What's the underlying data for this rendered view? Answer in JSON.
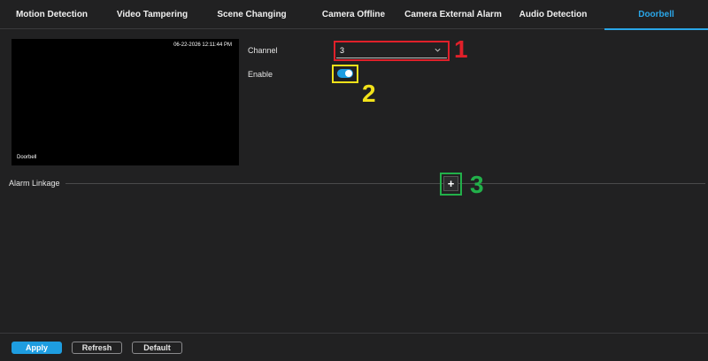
{
  "tabs": [
    {
      "label": "Motion Detection"
    },
    {
      "label": "Video Tampering"
    },
    {
      "label": "Scene Changing"
    },
    {
      "label": "Camera Offline"
    },
    {
      "label": "Camera External Alarm"
    },
    {
      "label": "Audio Detection"
    },
    {
      "label": "Doorbell"
    }
  ],
  "active_tab": "Doorbell",
  "preview": {
    "timestamp": "06-22-2026 12:11:44 PM",
    "camera_name": "Doorbell"
  },
  "form": {
    "channel_label": "Channel",
    "channel_value": "3",
    "enable_label": "Enable",
    "enable_on": true,
    "alarm_linkage_label": "Alarm Linkage",
    "add_symbol": "+"
  },
  "annotations": [
    {
      "number": "1",
      "color": "#e0202a"
    },
    {
      "number": "2",
      "color": "#f2e21a"
    },
    {
      "number": "3",
      "color": "#22b04a"
    }
  ],
  "footer": {
    "apply_label": "Apply",
    "refresh_label": "Refresh",
    "default_label": "Default"
  },
  "colors": {
    "accent": "#1e9de0",
    "background": "#212122"
  }
}
